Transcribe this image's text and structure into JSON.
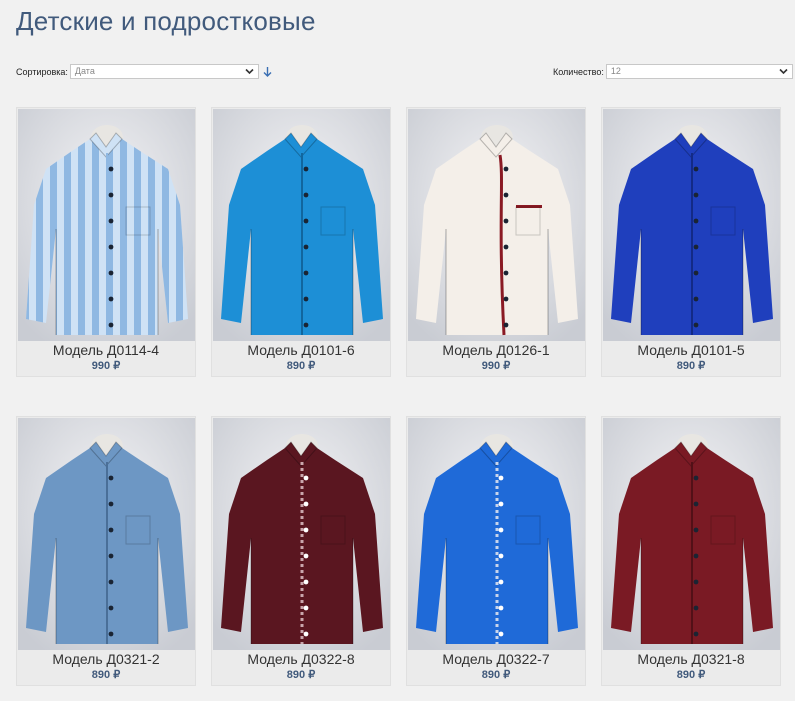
{
  "page": {
    "title": "Детские и подростковые"
  },
  "sort": {
    "label": "Сортировка:",
    "value": "Дата"
  },
  "count": {
    "label": "Количество:",
    "value": "12"
  },
  "products": [
    {
      "name": "Модель Д0114-4",
      "price": "990 ₽",
      "shirt": "striped",
      "color": "#cfe2f5",
      "accent": "#8fb8e2"
    },
    {
      "name": "Модель Д0101-6",
      "price": "890 ₽",
      "shirt": "plain",
      "color": "#1d8fd6",
      "accent": "#11669e"
    },
    {
      "name": "Модель Д0126-1",
      "price": "990 ₽",
      "shirt": "piping",
      "color": "#f4efe9",
      "accent": "#8a1a24"
    },
    {
      "name": "Модель Д0101-5",
      "price": "890 ₽",
      "shirt": "plain",
      "color": "#1f3fbd",
      "accent": "#132a86"
    },
    {
      "name": "Модель Д0321-2",
      "price": "890 ₽",
      "shirt": "plain",
      "color": "#6d97c4",
      "accent": "#4a6f98"
    },
    {
      "name": "Модель Д0322-8",
      "price": "890 ₽",
      "shirt": "contrast",
      "color": "#5a1620",
      "accent": "#c9a6ac"
    },
    {
      "name": "Модель Д0322-7",
      "price": "890 ₽",
      "shirt": "contrast",
      "color": "#1f6ad8",
      "accent": "#c9d5ec"
    },
    {
      "name": "Модель Д0321-8",
      "price": "890 ₽",
      "shirt": "plain",
      "color": "#7a1a24",
      "accent": "#521017"
    }
  ]
}
